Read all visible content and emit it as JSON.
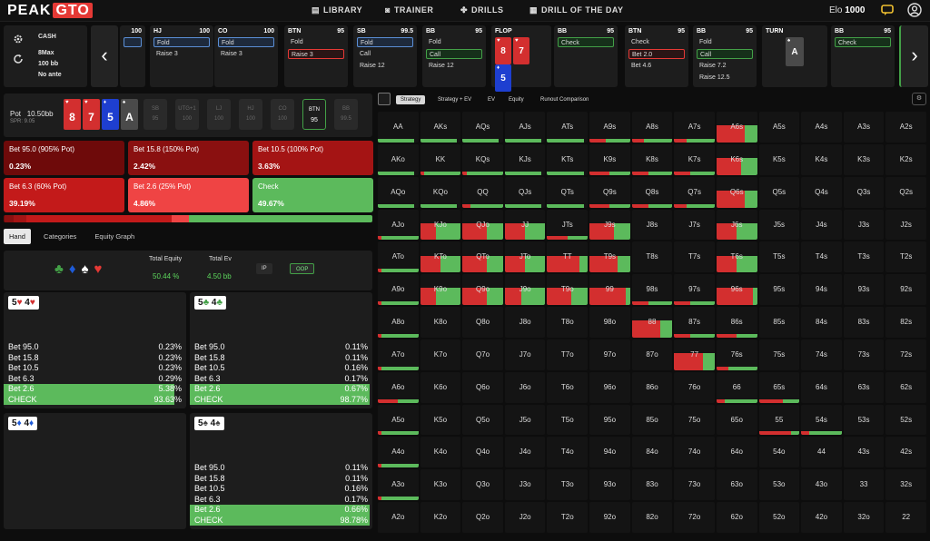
{
  "brand": {
    "name1": "PEAK",
    "name2": "GTO"
  },
  "nav": [
    {
      "label": "LIBRARY",
      "icon": "library-icon"
    },
    {
      "label": "TRAINER",
      "icon": "trainer-icon"
    },
    {
      "label": "DRILLS",
      "icon": "drills-icon"
    },
    {
      "label": "DRILL OF THE DAY",
      "icon": "calendar-icon"
    }
  ],
  "elo": {
    "label": "Elo",
    "value": "1000"
  },
  "game": {
    "type": "CASH",
    "format": "8Max",
    "stack": "100 bb",
    "ante": "No ante"
  },
  "path": [
    {
      "pos": "",
      "stack": "100",
      "actions": [
        {
          "t": "",
          "s": "blue"
        },
        {
          "t": "",
          "s": ""
        }
      ]
    },
    {
      "pos": "HJ",
      "stack": "100",
      "actions": [
        {
          "t": "Fold",
          "s": "blue"
        },
        {
          "t": "Raise 3",
          "s": ""
        }
      ]
    },
    {
      "pos": "CO",
      "stack": "100",
      "actions": [
        {
          "t": "Fold",
          "s": "blue"
        },
        {
          "t": "Raise 3",
          "s": ""
        }
      ]
    },
    {
      "pos": "BTN",
      "stack": "95",
      "actions": [
        {
          "t": "Fold",
          "s": ""
        },
        {
          "t": "Raise 3",
          "s": "red"
        }
      ]
    },
    {
      "pos": "SB",
      "stack": "99.5",
      "actions": [
        {
          "t": "Fold",
          "s": "blue"
        },
        {
          "t": "Call",
          "s": ""
        },
        {
          "t": "Raise 12",
          "s": ""
        }
      ]
    },
    {
      "pos": "BB",
      "stack": "95",
      "actions": [
        {
          "t": "Fold",
          "s": ""
        },
        {
          "t": "Call",
          "s": "green"
        },
        {
          "t": "Raise 12",
          "s": ""
        }
      ]
    },
    {
      "pos": "BB",
      "stack": "95",
      "actions": [
        {
          "t": "Check",
          "s": "green"
        }
      ]
    },
    {
      "pos": "BTN",
      "stack": "95",
      "actions": [
        {
          "t": "Check",
          "s": ""
        },
        {
          "t": "Bet 2.0",
          "s": "red"
        },
        {
          "t": "Bet 4.6",
          "s": ""
        }
      ]
    },
    {
      "pos": "BB",
      "stack": "95",
      "actions": [
        {
          "t": "Fold",
          "s": ""
        },
        {
          "t": "Call",
          "s": "green"
        },
        {
          "t": "Raise 7.2",
          "s": ""
        },
        {
          "t": "Raise 12.5",
          "s": ""
        }
      ]
    },
    {
      "pos": "BB",
      "stack": "95",
      "actions": [
        {
          "t": "Check",
          "s": "green"
        }
      ]
    }
  ],
  "flop": {
    "label": "FLOP",
    "cards": [
      {
        "r": "8",
        "s": "♥",
        "c": "#d32f2f"
      },
      {
        "r": "7",
        "s": "♥",
        "c": "#d32f2f"
      },
      {
        "r": "5",
        "s": "♦",
        "c": "#1e3fd0"
      }
    ]
  },
  "turn": {
    "label": "TURN",
    "card": {
      "r": "A",
      "s": "♠",
      "c": "#4a4a4a"
    }
  },
  "pot": {
    "label": "Pot",
    "value": "10.50bb",
    "spr": "SPR: 9.05"
  },
  "board": [
    {
      "r": "8",
      "s": "♥",
      "c": "#d32f2f"
    },
    {
      "r": "7",
      "s": "♥",
      "c": "#d32f2f"
    },
    {
      "r": "5",
      "s": "♦",
      "c": "#1e3fd0"
    },
    {
      "r": "A",
      "s": "♠",
      "c": "#4a4a4a"
    }
  ],
  "seats": [
    {
      "pos": "SB",
      "stack": "95",
      "active": false
    },
    {
      "pos": "UTG+1",
      "stack": "100",
      "active": false
    },
    {
      "pos": "LJ",
      "stack": "100",
      "active": false
    },
    {
      "pos": "HJ",
      "stack": "100",
      "active": false
    },
    {
      "pos": "CO",
      "stack": "100",
      "active": false
    },
    {
      "pos": "BTN",
      "stack": "95",
      "active": true
    },
    {
      "pos": "BB",
      "stack": "99.5",
      "active": false
    }
  ],
  "strategy": [
    {
      "label": "Bet 95.0 (905% Pot)",
      "pct": "0.23%",
      "color": "#6e0a0a"
    },
    {
      "label": "Bet 15.8 (150% Pot)",
      "pct": "2.42%",
      "color": "#8a1010"
    },
    {
      "label": "Bet 10.5 (100% Pot)",
      "pct": "3.63%",
      "color": "#a41414"
    },
    {
      "label": "Bet 6.3 (60% Pot)",
      "pct": "39.19%",
      "color": "#c31a1a"
    },
    {
      "label": "Bet 2.6 (25% Pot)",
      "pct": "4.86%",
      "color": "#ef4444"
    },
    {
      "label": "Check",
      "pct": "49.67%",
      "color": "#5cba5c"
    }
  ],
  "freq": [
    0.0023,
    0.0242,
    0.0363,
    0.3919,
    0.0486,
    0.4967
  ],
  "tabs": [
    "Hand",
    "Categories",
    "Equity Graph"
  ],
  "equity": {
    "eq_label": "Total Equity",
    "eq_value": "50.44 %",
    "ev_label": "Total Ev",
    "ev_value": "4.50 bb",
    "ip": "IP",
    "oop": "OOP"
  },
  "suits": [
    {
      "s": "♣",
      "c": "#43a047"
    },
    {
      "s": "♦",
      "c": "#1e5bd8"
    },
    {
      "s": "♠",
      "c": "#ffffff"
    },
    {
      "s": "♥",
      "c": "#e53935"
    }
  ],
  "combos": [
    {
      "r1": "5",
      "s1": "♥",
      "r2": "4",
      "s2": "♥",
      "c": "#d32f2f",
      "rows": [
        [
          "Bet 95.0",
          "0.23%"
        ],
        [
          "Bet 15.8",
          "0.23%"
        ],
        [
          "Bet 10.5",
          "0.23%"
        ],
        [
          "Bet 6.3",
          "0.29%"
        ],
        [
          "Bet 2.6",
          "5.38%"
        ],
        [
          "CHECK",
          "93.63%"
        ]
      ],
      "check": 0.9363,
      "b26": 0.0538
    },
    {
      "r1": "5",
      "s1": "♣",
      "r2": "4",
      "s2": "♣",
      "c": "#43a047",
      "rows": [
        [
          "Bet 95.0",
          "0.11%"
        ],
        [
          "Bet 15.8",
          "0.11%"
        ],
        [
          "Bet 10.5",
          "0.16%"
        ],
        [
          "Bet 6.3",
          "0.17%"
        ],
        [
          "Bet 2.6",
          "0.67%"
        ],
        [
          "CHECK",
          "98.77%"
        ]
      ],
      "check": 0.9877,
      "b26": 0.0067
    },
    {
      "r1": "5",
      "s1": "♦",
      "r2": "4",
      "s2": "♦",
      "c": "#1e5bd8",
      "rows": [],
      "check": 0,
      "b26": 0
    },
    {
      "r1": "5",
      "s1": "♠",
      "r2": "4",
      "s2": "♠",
      "c": "#444444",
      "rows": [
        [
          "Bet 95.0",
          "0.11%"
        ],
        [
          "Bet 15.8",
          "0.11%"
        ],
        [
          "Bet 10.5",
          "0.16%"
        ],
        [
          "Bet 6.3",
          "0.17%"
        ],
        [
          "Bet 2.6",
          "0.66%"
        ],
        [
          "CHECK",
          "98.78%"
        ]
      ],
      "check": 0.9878,
      "b26": 0.0066
    }
  ],
  "right_tabs": [
    "Strategy",
    "Strategy + EV",
    "EV",
    "Equity",
    "Runout Comparison"
  ],
  "ranks": [
    "A",
    "K",
    "Q",
    "J",
    "T",
    "9",
    "8",
    "7",
    "6",
    "5",
    "4",
    "3",
    "2"
  ],
  "cell_strategy": {
    "A9s": [
      0.4,
      0.6
    ],
    "A8s": [
      0.3,
      0.7
    ],
    "A7s": [
      0.3,
      0.7
    ],
    "A6s": [
      0.7,
      0.3
    ],
    "K9s": [
      0.5,
      0.5
    ],
    "K8s": [
      0.4,
      0.6
    ],
    "K7s": [
      0.4,
      0.6
    ],
    "K6s": [
      0.6,
      0.4
    ],
    "Q9s": [
      0.5,
      0.5
    ],
    "Q8s": [
      0.4,
      0.6
    ],
    "Q7s": [
      0.3,
      0.7
    ],
    "Q6s": [
      0.7,
      0.3
    ],
    "QQ": [
      0.2,
      0.8
    ],
    "KK": [
      0.1,
      0.9
    ],
    "KQs": [
      0.1,
      0.9
    ],
    "JTs": [
      0.5,
      0.5
    ],
    "J9s": [
      0.6,
      0.4
    ],
    "J6s": [
      0.5,
      0.5
    ],
    "KJo": [
      0.4,
      0.6
    ],
    "QJo": [
      0.6,
      0.4
    ],
    "JJ": [
      0.5,
      0.5
    ],
    "KTo": [
      0.5,
      0.5
    ],
    "QTo": [
      0.6,
      0.4
    ],
    "JTo": [
      0.5,
      0.5
    ],
    "TT": [
      0.8,
      0.2
    ],
    "T9s": [
      0.7,
      0.3
    ],
    "T6s": [
      0.5,
      0.5
    ],
    "K9o": [
      0.4,
      0.6
    ],
    "Q9o": [
      0.6,
      0.4
    ],
    "J9o": [
      0.4,
      0.6
    ],
    "T9o": [
      0.6,
      0.4
    ],
    "99": [
      0.9,
      0.1
    ],
    "98s": [
      0.4,
      0.6
    ],
    "97s": [
      0.4,
      0.6
    ],
    "96s": [
      0.9,
      0.1
    ],
    "88": [
      0.7,
      0.3
    ],
    "87s": [
      0.4,
      0.6
    ],
    "86s": [
      0.5,
      0.5
    ],
    "77": [
      0.7,
      0.3
    ],
    "76s": [
      0.3,
      0.7
    ],
    "66": [
      0.2,
      0.8
    ],
    "65s": [
      0.6,
      0.4
    ],
    "55": [
      0.8,
      0.2
    ],
    "54s": [
      0.2,
      0.8
    ],
    "A6o": [
      0.5,
      0.5
    ],
    "AJo": [
      0.1,
      0.9
    ],
    "ATo": [
      0.1,
      0.9
    ],
    "A9o": [
      0.1,
      0.9
    ],
    "A8o": [
      0.1,
      0.9
    ],
    "A7o": [
      0.1,
      0.9
    ],
    "A5o": [
      0.1,
      0.9
    ],
    "A4o": [
      0.1,
      0.9
    ],
    "A3o": [
      0.1,
      0.9
    ]
  },
  "hi_cells": [
    "A6s",
    "K6s",
    "Q6s",
    "JJ",
    "J9s",
    "T9s",
    "TT",
    "99",
    "96s",
    "K9o",
    "Q9o",
    "J9o",
    "T9o",
    "KTo",
    "QTo",
    "JTo",
    "T6s",
    "KJo",
    "QJo",
    "J6s",
    "88",
    "77"
  ],
  "icons": {
    "settings": "gear-icon",
    "refresh": "refresh-icon",
    "prev": "chevron-left-icon",
    "next": "chevron-right-icon",
    "chat": "chat-icon",
    "user": "user-icon",
    "view": "view-toggle-icon"
  }
}
